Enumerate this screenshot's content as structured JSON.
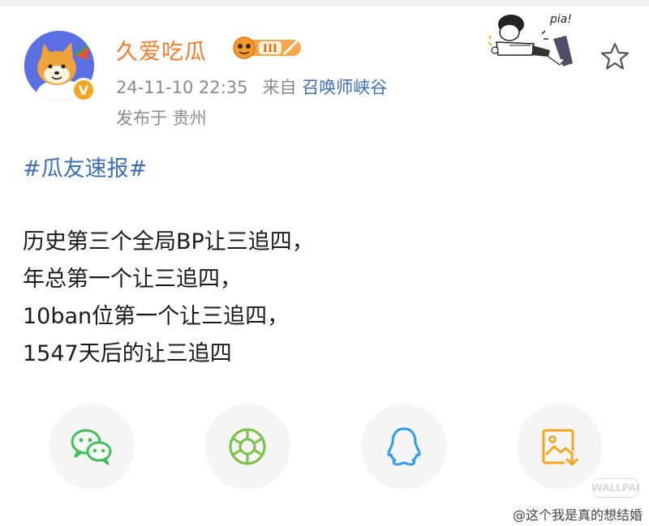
{
  "post": {
    "author": "久爱吃瓜",
    "level": "III",
    "timestamp": "24-11-10 22:35",
    "source_prefix": "来自",
    "source": "召唤师峡谷",
    "location": "发布于 贵州",
    "hashtag": "#瓜友速报#",
    "lines": [
      "历史第三个全局BP让三追四，",
      "年总第一个让三追四，",
      "10ban位第一个让三追四，",
      "1547天后的让三追四"
    ]
  },
  "sticker": {
    "text": "pia!"
  },
  "share": [
    {
      "name": "wechat",
      "icon": "wechat-icon",
      "color": "#3fbf5a"
    },
    {
      "name": "moments",
      "icon": "moments-icon",
      "color": "#78c144"
    },
    {
      "name": "qq",
      "icon": "qq-icon",
      "color": "#2d9cf0"
    },
    {
      "name": "save-image",
      "icon": "save-image-icon",
      "color": "#f6a21a"
    }
  ],
  "watermark": {
    "logo": "WALLPAI",
    "text": "@这个我是真的想结婚"
  },
  "colors": {
    "username": "#f17a2a",
    "link": "#3b6fb6",
    "meta": "#8a8a8a"
  }
}
